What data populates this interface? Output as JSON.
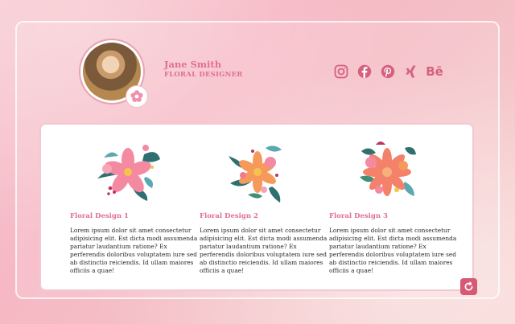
{
  "profile": {
    "name": "Jane Smith",
    "role": "FLORAL DESIGNER",
    "avatar_icon": "person-portrait",
    "badge_icon": "flower-badge-icon"
  },
  "socials": [
    {
      "name": "instagram",
      "icon": "instagram-icon"
    },
    {
      "name": "facebook",
      "icon": "facebook-icon"
    },
    {
      "name": "pinterest",
      "icon": "pinterest-icon"
    },
    {
      "name": "xing",
      "icon": "xing-icon"
    },
    {
      "name": "behance",
      "icon": "behance-icon",
      "glyph": "Bē"
    }
  ],
  "designs": [
    {
      "title": "Floral Design 1",
      "text": "Lorem ipsum dolor sit amet consectetur adipisicing elit. Est dicta modi assumenda pariatur laudantium ratione? Ex perferendis doloribus voluptatem iure sed ab distinctio reiciendis. Id ullam maiores officiis a quae!"
    },
    {
      "title": "Floral Design 2",
      "text": "Lorem ipsum dolor sit amet consectetur adipisicing elit. Est dicta modi assumenda pariatur laudantium ratione? Ex perferendis doloribus voluptatem iure sed ab distinctio reiciendis. Id ullam maiores officiis a quae!"
    },
    {
      "title": "Floral Design 3",
      "text": "Lorem ipsum dolor sit amet consectetur adipisicing elit. Est dicta modi assumenda pariatur laudantium ratione? Ex perferendis doloribus voluptatem iure sed ab distinctio reiciendis. Id ullam maiores officiis a quae!"
    }
  ],
  "refresh_icon": "refresh-icon",
  "colors": {
    "accent": "#e06f90",
    "icon": "#d6607f",
    "button": "#d65a76"
  }
}
